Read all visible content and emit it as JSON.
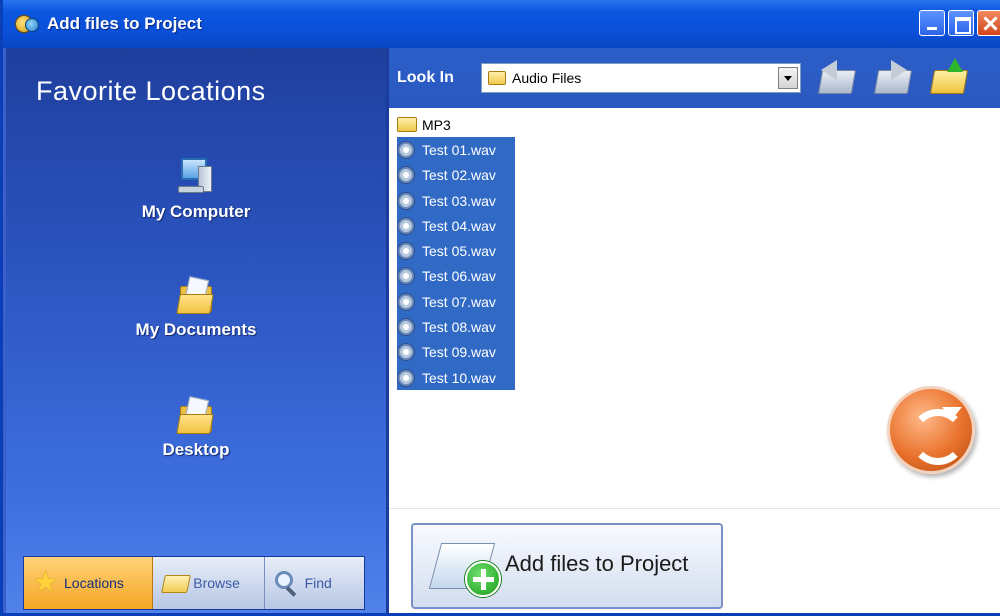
{
  "window": {
    "title": "Add files to Project"
  },
  "left_panel": {
    "heading": "Favorite Locations",
    "locations": [
      {
        "label": "My Computer",
        "icon": "computer-icon"
      },
      {
        "label": "My Documents",
        "icon": "documents-folder-icon"
      },
      {
        "label": "Desktop",
        "icon": "desktop-folder-icon"
      }
    ],
    "tabs": [
      {
        "label": "Locations",
        "icon": "star-icon",
        "active": true
      },
      {
        "label": "Browse",
        "icon": "folder-icon",
        "active": false
      },
      {
        "label": "Find",
        "icon": "magnifier-icon",
        "active": false
      }
    ]
  },
  "toolbar": {
    "look_in_label": "Look In",
    "look_in_value": "Audio Files",
    "buttons": [
      "back-icon",
      "forward-icon",
      "up-folder-icon"
    ]
  },
  "files": [
    {
      "name": "MP3",
      "type": "folder",
      "selected": false
    },
    {
      "name": "Test 01.wav",
      "type": "wav",
      "selected": true
    },
    {
      "name": "Test 02.wav",
      "type": "wav",
      "selected": true
    },
    {
      "name": "Test 03.wav",
      "type": "wav",
      "selected": true
    },
    {
      "name": "Test 04.wav",
      "type": "wav",
      "selected": true
    },
    {
      "name": "Test 05.wav",
      "type": "wav",
      "selected": true
    },
    {
      "name": "Test 06.wav",
      "type": "wav",
      "selected": true
    },
    {
      "name": "Test 07.wav",
      "type": "wav",
      "selected": true
    },
    {
      "name": "Test 08.wav",
      "type": "wav",
      "selected": true
    },
    {
      "name": "Test 09.wav",
      "type": "wav",
      "selected": true
    },
    {
      "name": "Test 10.wav",
      "type": "wav",
      "selected": true
    }
  ],
  "actions": {
    "add_button_label": "Add files to Project",
    "refresh_icon": "refresh-icon"
  },
  "colors": {
    "title_bar": "#0a4fd8",
    "selection": "#316ac5",
    "active_tab": "#f5a623"
  }
}
